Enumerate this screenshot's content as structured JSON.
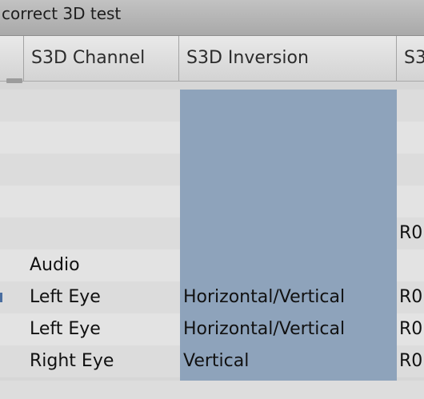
{
  "window": {
    "title": "correct 3D test"
  },
  "columns": [
    {
      "label": ""
    },
    {
      "label": "S3D Channel"
    },
    {
      "label": "S3D Inversion"
    },
    {
      "label": "S3"
    }
  ],
  "rows": [
    {
      "channel": "",
      "inversion": "",
      "s3": ""
    },
    {
      "channel": "",
      "inversion": "",
      "s3": ""
    },
    {
      "channel": "",
      "inversion": "",
      "s3": ""
    },
    {
      "channel": "",
      "inversion": "",
      "s3": ""
    },
    {
      "channel": "",
      "inversion": "",
      "s3": "R0"
    },
    {
      "channel": "Audio",
      "inversion": "",
      "s3": ""
    },
    {
      "channel": "Left Eye",
      "inversion": "Horizontal/Vertical",
      "s3": "R0"
    },
    {
      "channel": "Left Eye",
      "inversion": "Horizontal/Vertical",
      "s3": "R0"
    },
    {
      "channel": "Right Eye",
      "inversion": "Vertical",
      "s3": "R0"
    }
  ],
  "colors": {
    "selected_column": "#8ea3bb",
    "row_even": "#dcdcdc",
    "row_odd": "#e3e3e3"
  }
}
